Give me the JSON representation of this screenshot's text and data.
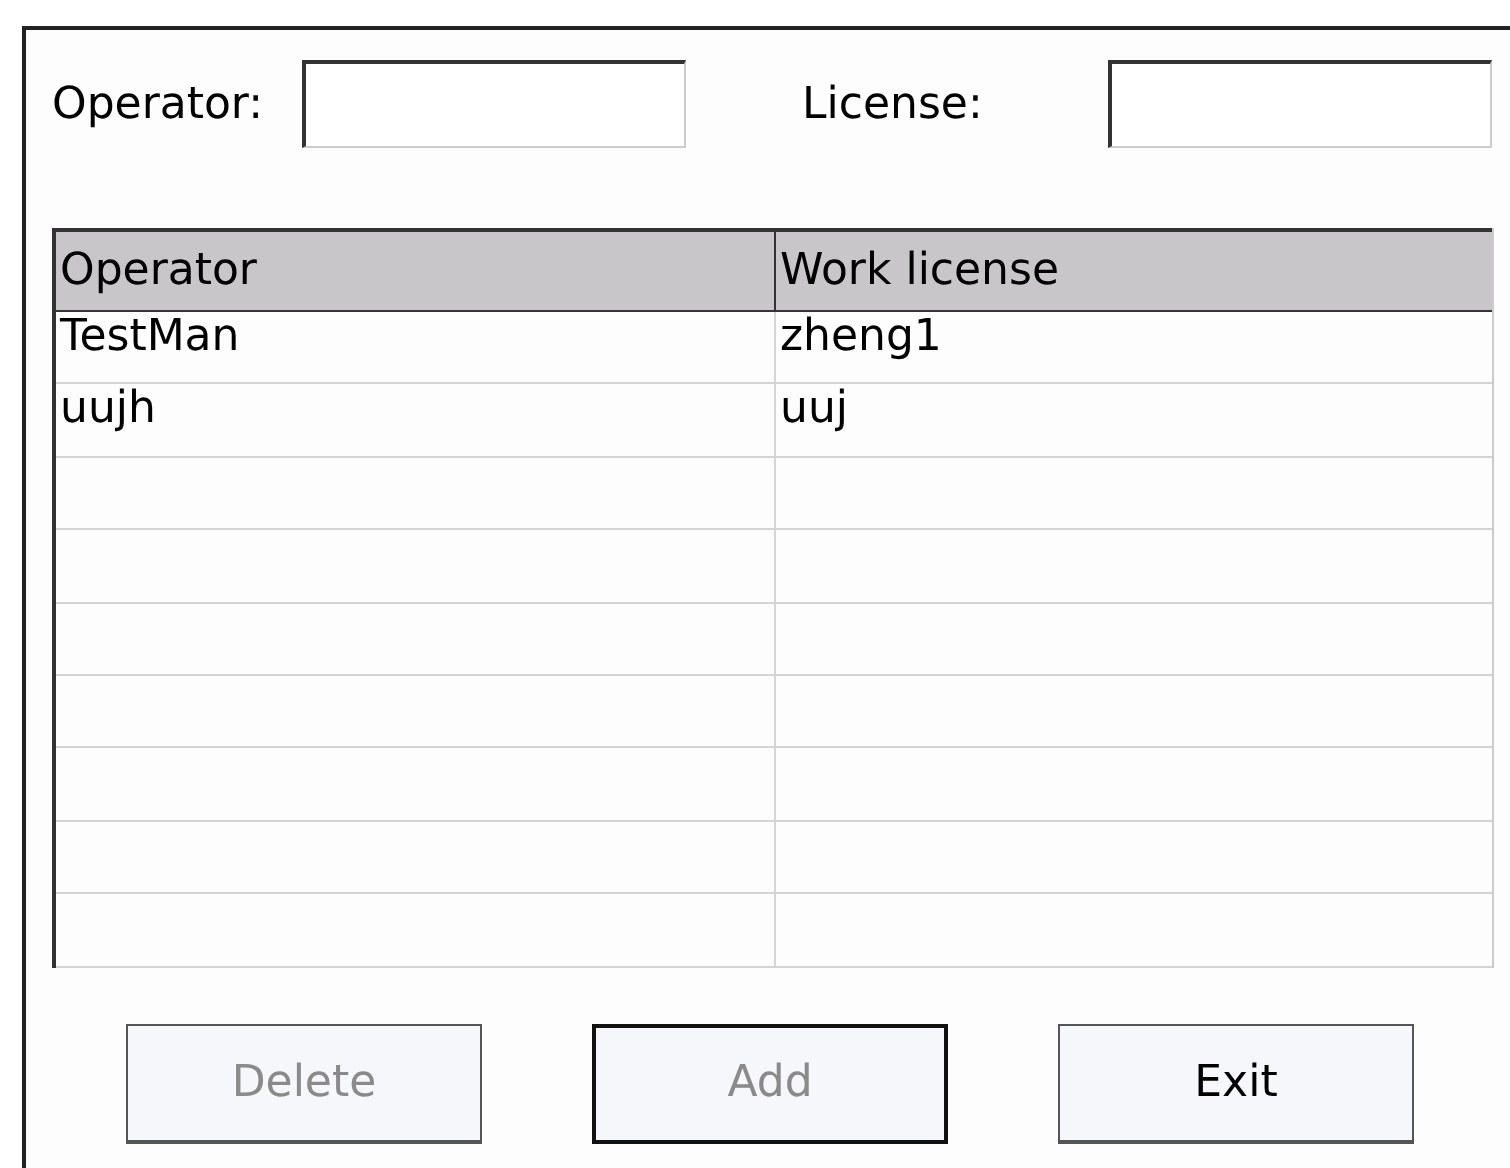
{
  "fields": [
    {
      "label": "Operator:"
    },
    {
      "label": "License:"
    }
  ],
  "table": {
    "columns": [
      "Operator",
      "Work license"
    ],
    "rows": [
      [
        "TestMan",
        "zheng1"
      ],
      [
        "uujh",
        "uuj"
      ]
    ]
  },
  "buttons": [
    {
      "label": "Delete",
      "disabled": true,
      "default": false
    },
    {
      "label": "Add",
      "disabled": true,
      "default": true
    },
    {
      "label": "Exit",
      "disabled": false,
      "default": false
    }
  ]
}
